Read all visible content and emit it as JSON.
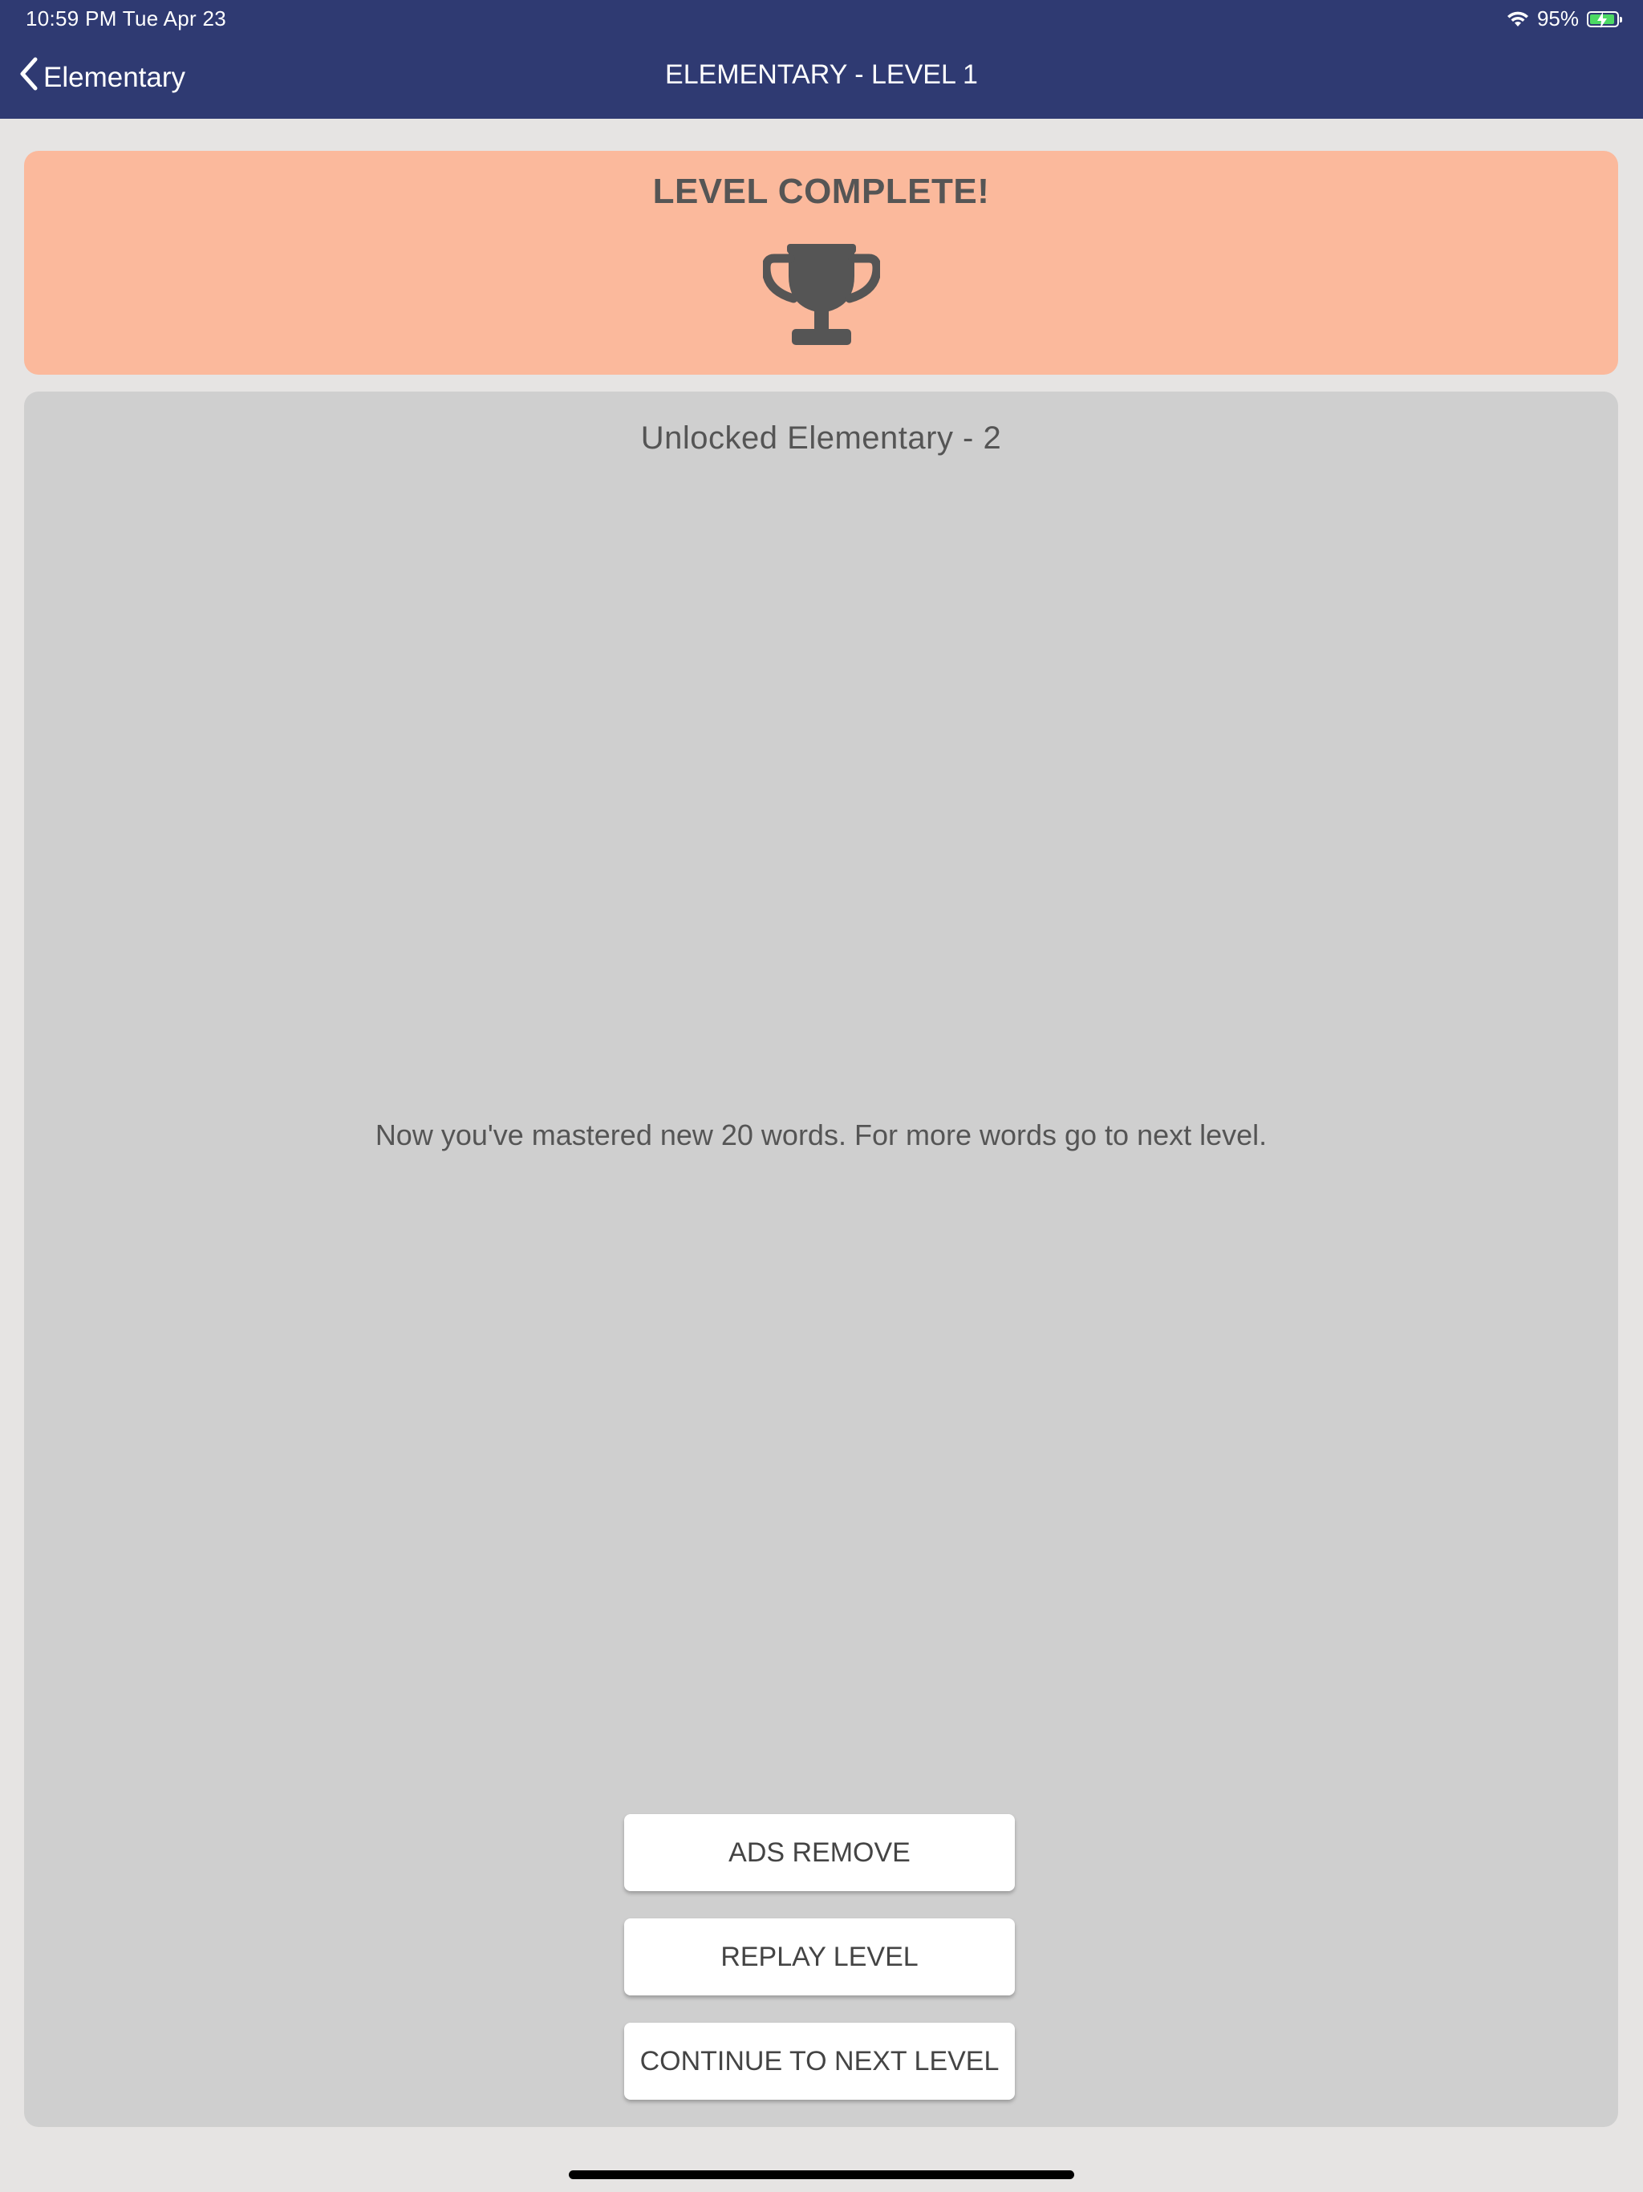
{
  "status_bar": {
    "time": "10:59 PM   Tue Apr 23",
    "battery_percent": "95%"
  },
  "nav": {
    "back_label": "Elementary",
    "title": "ELEMENTARY - LEVEL 1"
  },
  "complete_card": {
    "title": "LEVEL COMPLETE!",
    "icon": "trophy-icon",
    "background_color": "#fbb99c"
  },
  "main_card": {
    "unlocked_title": "Unlocked Elementary - 2",
    "message": "Now you've mastered new 20 words. For more words go to next level."
  },
  "buttons": {
    "ads_remove": "ADS REMOVE",
    "replay_level": "REPLAY LEVEL",
    "continue_next": "CONTINUE TO NEXT LEVEL"
  },
  "colors": {
    "nav_background": "#2f3a72",
    "card_background": "#cfcfcf",
    "text": "#555555"
  }
}
